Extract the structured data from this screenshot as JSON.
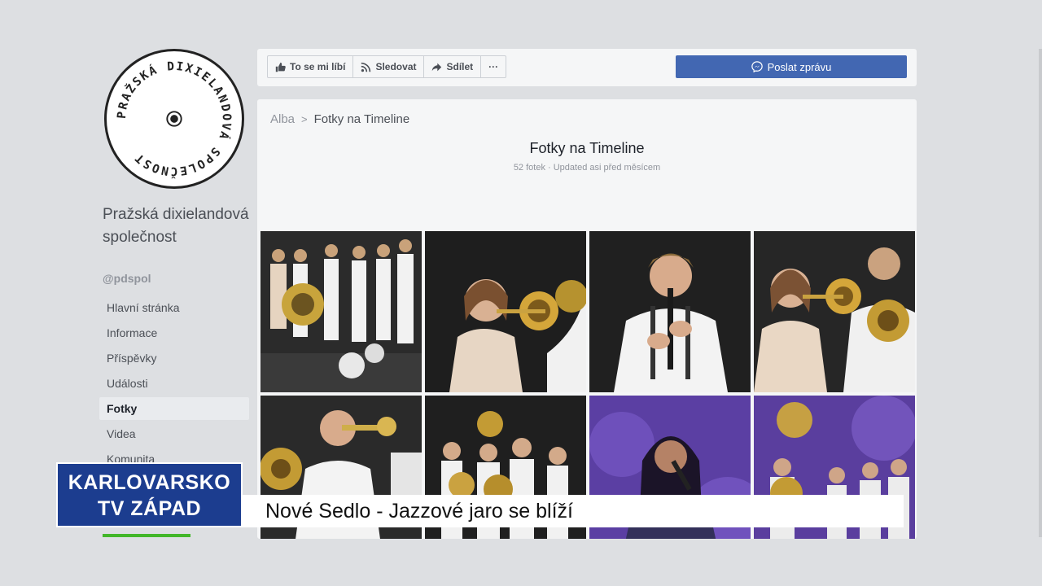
{
  "profile": {
    "logo_text": "PRAŽSKÁ DIXIELANDOVÁ SPOLEČNOST",
    "name": "Pražská dixielandová společnost",
    "handle": "@pdspol"
  },
  "nav": {
    "items": [
      {
        "label": "Hlavní stránka"
      },
      {
        "label": "Informace"
      },
      {
        "label": "Příspěvky"
      },
      {
        "label": "Události"
      },
      {
        "label": "Fotky",
        "active": true
      },
      {
        "label": "Videa"
      },
      {
        "label": "Komunita"
      }
    ]
  },
  "actions": {
    "like_label": "To se mi líbí",
    "follow_label": "Sledovat",
    "share_label": "Sdílet",
    "more_label": "···",
    "message_label": "Poslat zprávu"
  },
  "album": {
    "breadcrumb_root": "Alba",
    "breadcrumb_sep": ">",
    "breadcrumb_current": "Fotky na Timeline",
    "title": "Fotky na Timeline",
    "meta": "52 fotek · Updated asi před měsícem"
  },
  "overlay": {
    "channel_line1": "KARLOVARSKO",
    "channel_line2": "TV ZÁPAD",
    "headline": "Nové Sedlo - Jazzové jaro se blíží"
  },
  "colors": {
    "accent": "#4267b2",
    "channel_bg": "#1c3d8f",
    "page_bg": "#dddfe2"
  }
}
